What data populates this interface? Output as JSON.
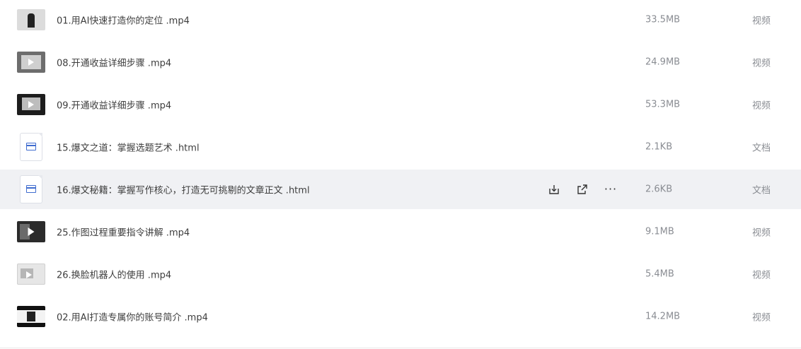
{
  "files": [
    {
      "name": "01.用AI快速打造你的定位  .mp4",
      "size": "33.5MB",
      "type": "视频",
      "icon": "video-thumbnail"
    },
    {
      "name": "08.开通收益详细步骤  .mp4",
      "size": "24.9MB",
      "type": "视频",
      "icon": "video-thumbnail"
    },
    {
      "name": "09.开通收益详细步骤  .mp4",
      "size": "53.3MB",
      "type": "视频",
      "icon": "video-thumbnail"
    },
    {
      "name": "15.爆文之道：掌握选题艺术 .html",
      "size": "2.1KB",
      "type": "文档",
      "icon": "html-doc-icon"
    },
    {
      "name": "16.爆文秘籍：掌握写作核心，打造无可挑剔的文章正文 .html",
      "size": "2.6KB",
      "type": "文档",
      "icon": "html-doc-icon",
      "hovered": true
    },
    {
      "name": "25.作图过程重要指令讲解  .mp4",
      "size": "9.1MB",
      "type": "视频",
      "icon": "video-thumbnail"
    },
    {
      "name": "26.换脸机器人的使用  .mp4",
      "size": "5.4MB",
      "type": "视频",
      "icon": "video-thumbnail"
    },
    {
      "name": "02.用AI打造专属你的账号简介  .mp4",
      "size": "14.2MB",
      "type": "视频",
      "icon": "video-thumbnail"
    }
  ],
  "row_actions": {
    "download": "download-icon",
    "share": "share-icon",
    "more": "more-icon",
    "more_label": "···"
  },
  "colors": {
    "hover_row": "#f0f1f4",
    "doc_icon_accent": "#3f6ccf",
    "meta_text": "#8a8d93"
  }
}
